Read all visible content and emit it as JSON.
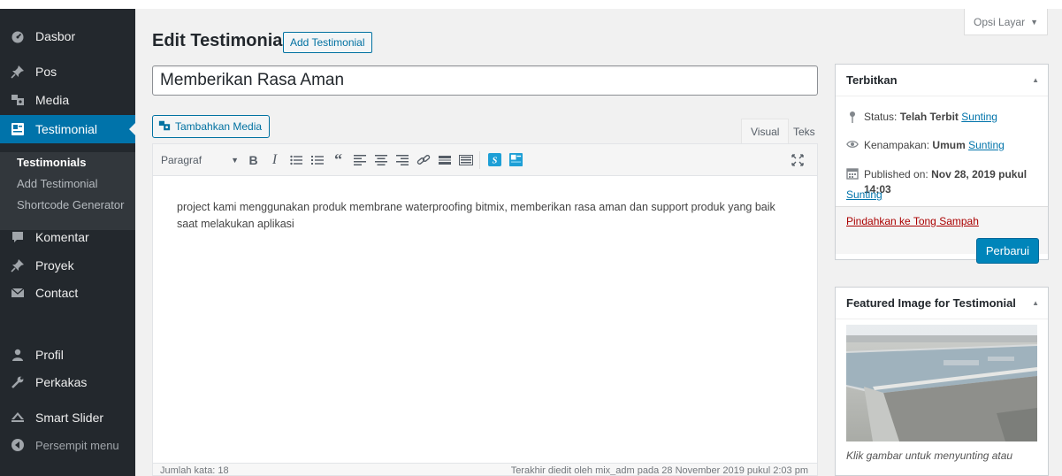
{
  "sidebar": {
    "items": [
      {
        "label": "Dasbor",
        "icon": "dashboard-icon"
      },
      {
        "label": "Pos",
        "icon": "pin-icon"
      },
      {
        "label": "Media",
        "icon": "media-icon"
      },
      {
        "label": "Testimonial",
        "icon": "testimonial-icon",
        "active": true
      },
      {
        "label": "Komentar",
        "icon": "comment-icon"
      },
      {
        "label": "Proyek",
        "icon": "pin-icon"
      },
      {
        "label": "Contact",
        "icon": "mail-icon"
      },
      {
        "label": "Profil",
        "icon": "user-icon"
      },
      {
        "label": "Perkakas",
        "icon": "wrench-icon"
      },
      {
        "label": "Smart Slider",
        "icon": "slider-icon"
      },
      {
        "label": "Persempit menu",
        "icon": "collapse-icon"
      }
    ],
    "submenu": [
      "Testimonials",
      "Add Testimonial",
      "Shortcode Generator"
    ]
  },
  "header": {
    "title": "Edit Testimonial",
    "add_button": "Add Testimonial",
    "screen_options": "Opsi Layar"
  },
  "post": {
    "title": "Memberikan Rasa Aman",
    "content": "project kami menggunakan produk membrane waterproofing bitmix, memberikan rasa aman dan support produk yang baik saat melakukan aplikasi"
  },
  "editor": {
    "add_media": "Tambahkan Media",
    "tab_visual": "Visual",
    "tab_text": "Teks",
    "format": "Paragraf",
    "word_count": "Jumlah kata: 18",
    "last_edited": "Terakhir diedit oleh mix_adm pada 28 November 2019 pukul 2:03 pm"
  },
  "publish": {
    "title": "Terbitkan",
    "status_label": "Status:",
    "status_value": "Telah Terbit",
    "visibility_label": "Kenampakan:",
    "visibility_value": "Umum",
    "published_label": "Published on:",
    "published_value": "Nov 28, 2019 pukul 14:03",
    "edit_link": "Sunting",
    "trash": "Pindahkan ke Tong Sampah",
    "update": "Perbarui"
  },
  "featured": {
    "title": "Featured Image for Testimonial",
    "caption": "Klik gambar untuk menyunting atau"
  },
  "colors": {
    "sidebar_bg": "#23282d",
    "active_bg": "#0073aa",
    "primary_button": "#0085ba",
    "link": "#0073aa",
    "trash": "#aa0000"
  }
}
